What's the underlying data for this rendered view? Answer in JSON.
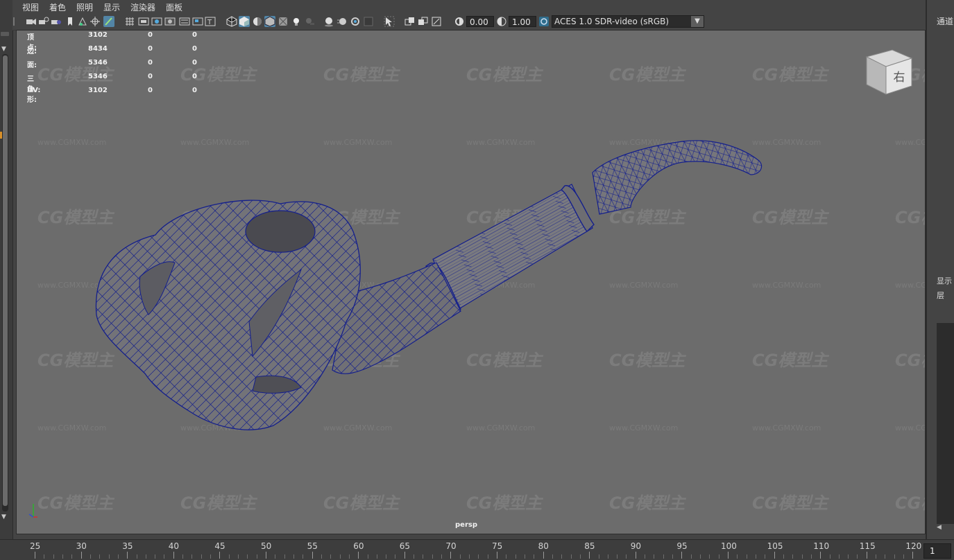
{
  "menu": {
    "items": [
      "视图",
      "着色",
      "照明",
      "显示",
      "渲染器",
      "面板"
    ]
  },
  "toolbar": {
    "exposure_value": "0.00",
    "gamma_value": "1.00",
    "color_management_value": "ACES 1.0 SDR-video (sRGB)",
    "icons": [
      "select-camera-icon",
      "camera-attributes-icon",
      "bookmark-icon",
      "image-plane-icon",
      "2d-pan-zoom-icon",
      "grease-pencil-icon",
      "grid-icon",
      "film-gate-icon",
      "resolution-gate-icon",
      "gate-mask-icon",
      "field-chart-icon",
      "safe-action-icon",
      "safe-title-icon",
      "wireframe-icon",
      "smooth-shade-icon",
      "use-default-material-icon",
      "wireframe-on-shaded-icon",
      "xray-icon",
      "xray-joints-icon",
      "use-all-lights-icon",
      "shadows-icon",
      "screen-space-ao-icon",
      "motion-blur-icon",
      "multisample-aa-icon",
      "depth-of-field-icon",
      "isolate-select-icon",
      "xray-component-icon",
      "two-sided-lighting-icon",
      "flip-icon",
      "exposure-icon",
      "gamma-icon",
      "color-management-icon"
    ]
  },
  "hud": {
    "rows": [
      {
        "label": "顶点:",
        "v1": "3102",
        "v2": "0",
        "v3": "0"
      },
      {
        "label": "边:",
        "v1": "8434",
        "v2": "0",
        "v3": "0"
      },
      {
        "label": "面:",
        "v1": "5346",
        "v2": "0",
        "v3": "0"
      },
      {
        "label": "三角形:",
        "v1": "5346",
        "v2": "0",
        "v3": "0"
      },
      {
        "label": "UV:",
        "v1": "3102",
        "v2": "0",
        "v3": "0"
      }
    ]
  },
  "viewcube": {
    "face_label": "右"
  },
  "watermark": {
    "logo_text": "CG模型主",
    "url_text": "www.CGMXW.com"
  },
  "viewport": {
    "camera_label": "persp"
  },
  "right_panel": {
    "channels_label": "通道",
    "display_label": "显示",
    "layer_label": "层"
  },
  "timeline": {
    "ticks": [
      "25",
      "30",
      "35",
      "40",
      "45",
      "50",
      "55",
      "60",
      "65",
      "70",
      "75",
      "80",
      "85",
      "90",
      "95",
      "100",
      "105",
      "110",
      "115",
      "120"
    ],
    "current_frame": "1"
  },
  "colors": {
    "wireframe": "#141f8c",
    "mesh_fill": "#737378",
    "viewport_bg": "#6c6c6c",
    "selection_blue": "#5285a6"
  }
}
